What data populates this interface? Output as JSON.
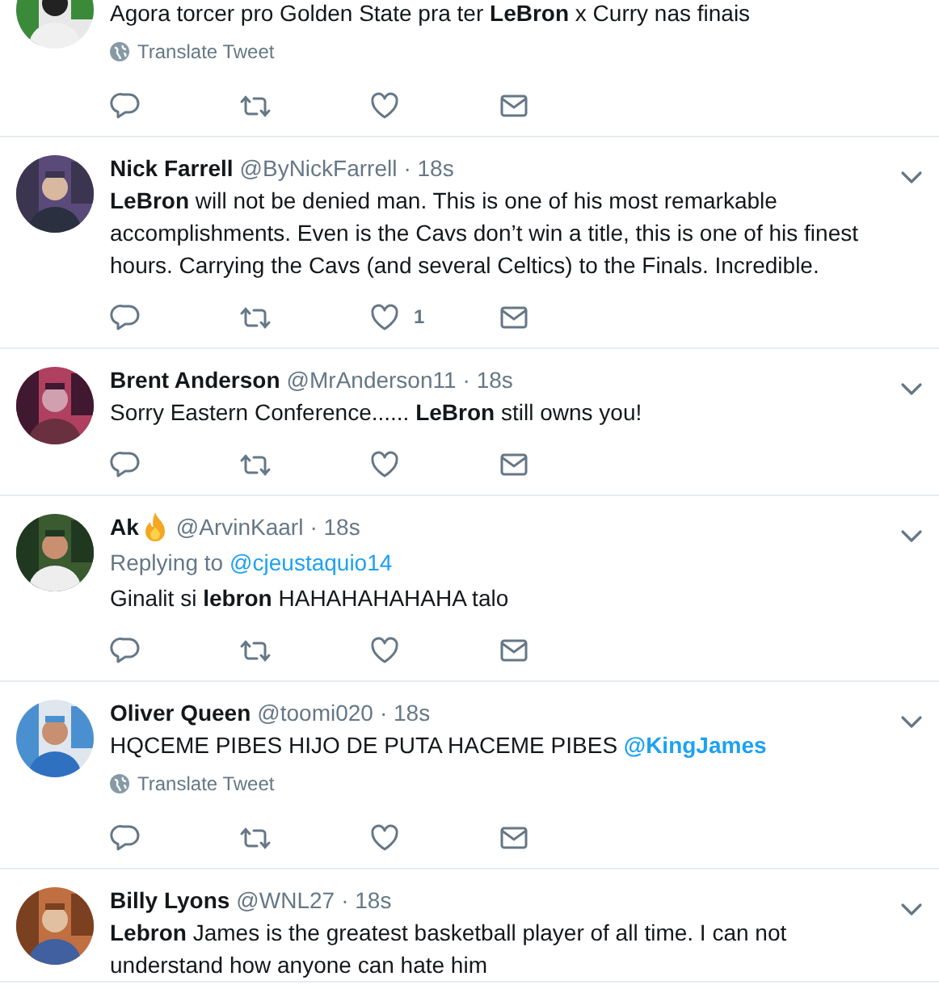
{
  "tweets": [
    {
      "text": "Agora torcer pro Golden State pra ter **LeBron** x Curry nas finais",
      "translate": "Translate Tweet"
    },
    {
      "name": "Nick Farrell",
      "handle": "@ByNickFarrell",
      "time": "· 18s",
      "text": "**LeBron** will not be denied man. This is one of his most remarkable accomplishments. Even is the Cavs don’t win a title, this is one of his finest hours. Carrying the Cavs (and several Celtics) to the Finals. Incredible.",
      "like_count": "1",
      "menu": true
    },
    {
      "name": "Brent Anderson",
      "handle": "@MrAnderson11",
      "time": "· 18s",
      "text": "Sorry Eastern Conference...... **LeBron** still owns you!",
      "menu": true
    },
    {
      "name": "Ak",
      "name_icon": true,
      "handle": "@ArvinKaarl",
      "time": "· 18s",
      "replying_label": "Replying to",
      "replying_to": "@cjeustaquio14",
      "text": "Ginalit si **lebron** HAHAHAHAHAHA talo",
      "menu": true
    },
    {
      "name": "Oliver Queen",
      "handle": "@toomi020",
      "time": "· 18s",
      "text": "HQCEME PIBES HIJO DE PUTA HACEME PIBES",
      "link": "@KingJames",
      "translate": "Translate Tweet",
      "menu": true
    },
    {
      "name": "Billy Lyons",
      "handle": "@WNL27",
      "time": "· 18s",
      "text": "**Lebron** James is the greatest basketball player of all time. I can not understand how anyone can hate him",
      "menu": true
    }
  ]
}
